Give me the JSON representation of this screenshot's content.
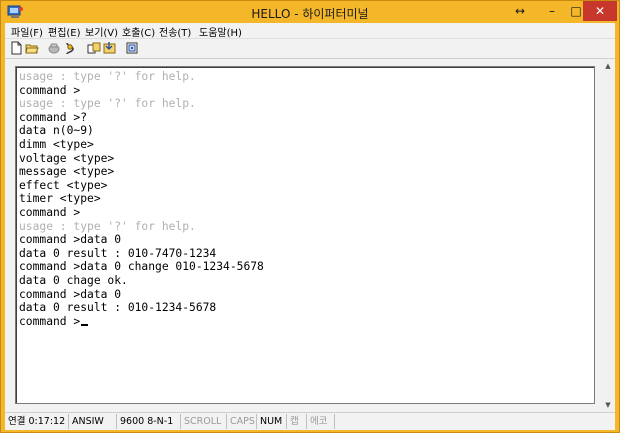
{
  "window": {
    "title": "HELLO - 하이퍼터미널"
  },
  "titlebar_buttons": {
    "resize": "↔",
    "minimize": "–",
    "maximize": "□",
    "close": "✕"
  },
  "menu": [
    "파일(F)",
    "편집(E)",
    "보기(V)",
    "호출(C)",
    "전송(T)",
    "도움말(H)"
  ],
  "toolbar": [
    {
      "icon": "new-document-icon"
    },
    {
      "icon": "open-folder-icon"
    },
    {
      "icon": "call-icon"
    },
    {
      "icon": "disconnect-icon"
    },
    {
      "icon": "send-icon"
    },
    {
      "icon": "receive-icon"
    },
    {
      "icon": "properties-icon"
    }
  ],
  "terminal": {
    "lines": [
      {
        "text": "usage : type '?' for help.",
        "dim": true
      },
      {
        "text": "command >",
        "dim": false
      },
      {
        "text": "usage : type '?' for help.",
        "dim": true
      },
      {
        "text": "command >?",
        "dim": false
      },
      {
        "text": "data n(0~9)",
        "dim": false
      },
      {
        "text": "dimm <type>",
        "dim": false
      },
      {
        "text": "voltage <type>",
        "dim": false
      },
      {
        "text": "message <type>",
        "dim": false
      },
      {
        "text": "effect <type>",
        "dim": false
      },
      {
        "text": "timer <type>",
        "dim": false
      },
      {
        "text": "command >",
        "dim": false
      },
      {
        "text": "usage : type '?' for help.",
        "dim": true
      },
      {
        "text": "command >data 0",
        "dim": false
      },
      {
        "text": "data 0 result : 010-7470-1234",
        "dim": false
      },
      {
        "text": "command >data 0 change 010-1234-5678",
        "dim": false
      },
      {
        "text": "data 0 chage ok.",
        "dim": false
      },
      {
        "text": "command >data 0",
        "dim": false
      },
      {
        "text": "data 0 result : 010-1234-5678",
        "dim": false
      },
      {
        "text": "command >",
        "dim": false,
        "cursor": true
      }
    ]
  },
  "statusbar": {
    "connected": "연결 0:17:12",
    "emulation": "ANSIW",
    "port_settings": "9600 8-N-1",
    "scroll": "SCROLL",
    "caps": "CAPS",
    "num": "NUM",
    "capture": "캡",
    "echo": "에코"
  },
  "colors": {
    "frame": "#f4b72a",
    "close": "#c7372b",
    "dim_text": "#b0b0b0"
  }
}
